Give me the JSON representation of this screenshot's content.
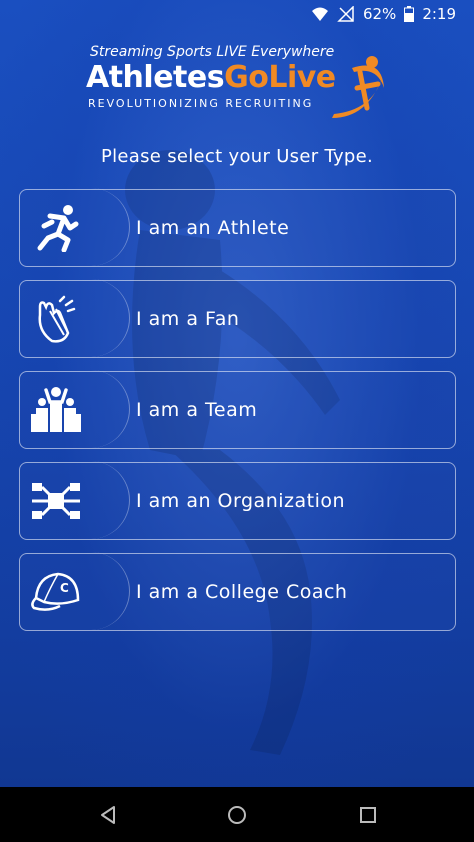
{
  "status": {
    "battery": "62%",
    "time": "2:19",
    "icons": [
      "wifi-icon",
      "signal-off-icon",
      "battery-icon"
    ]
  },
  "logo": {
    "tagline": "Streaming Sports LIVE Everywhere",
    "brand_part1": "Athletes",
    "brand_part2": "GoLive",
    "slogan": "REVOLUTIONIZING RECRUITING",
    "brand_colors": {
      "white": "#ffffff",
      "orange": "#f08a24"
    }
  },
  "prompt": "Please select your User Type.",
  "options": [
    {
      "label": "I am an Athlete",
      "icon": "runner-icon"
    },
    {
      "label": "I am a Fan",
      "icon": "clapping-hands-icon"
    },
    {
      "label": "I am a Team",
      "icon": "team-icon"
    },
    {
      "label": "I am an Organization",
      "icon": "network-icon"
    },
    {
      "label": "I am a College Coach",
      "icon": "cap-icon"
    }
  ],
  "nav": [
    "back-icon",
    "home-icon",
    "recents-icon"
  ],
  "colors": {
    "background": "#1747b2",
    "navbar": "#000000"
  }
}
